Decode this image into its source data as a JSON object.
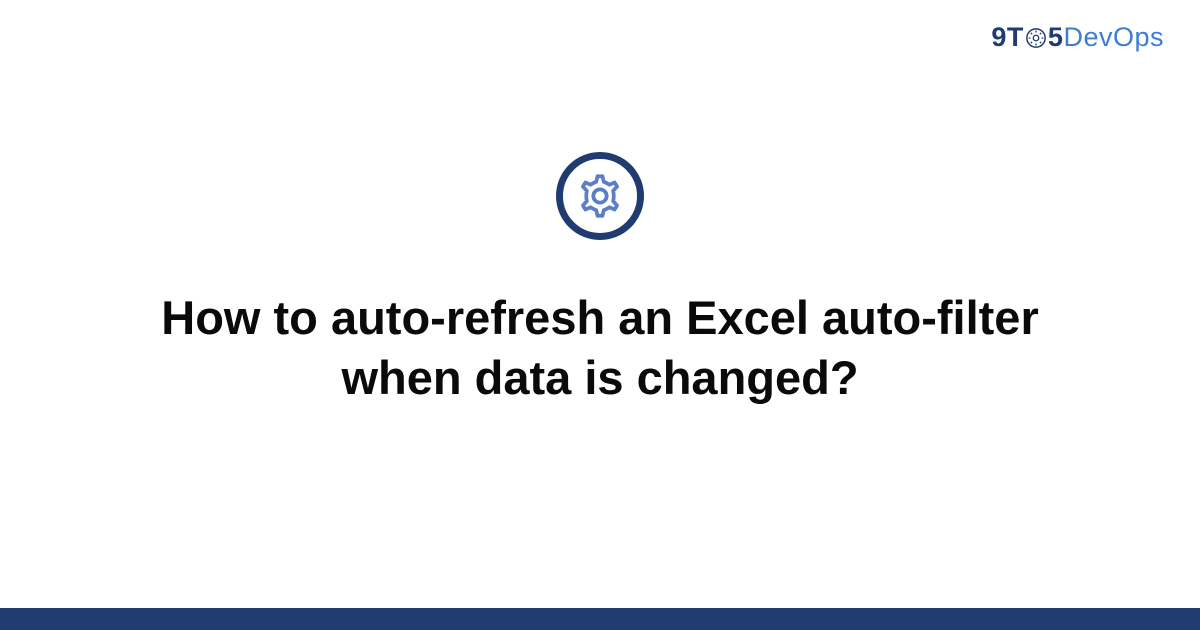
{
  "logo": {
    "prefix": "9T",
    "mid": "5",
    "suffix": "DevOps"
  },
  "title": "How to auto-refresh an Excel auto-filter when data is changed?",
  "colors": {
    "brand_dark": "#1f3b6f",
    "brand_light": "#3b7dd8",
    "gear_stroke": "#5b7fc7"
  }
}
